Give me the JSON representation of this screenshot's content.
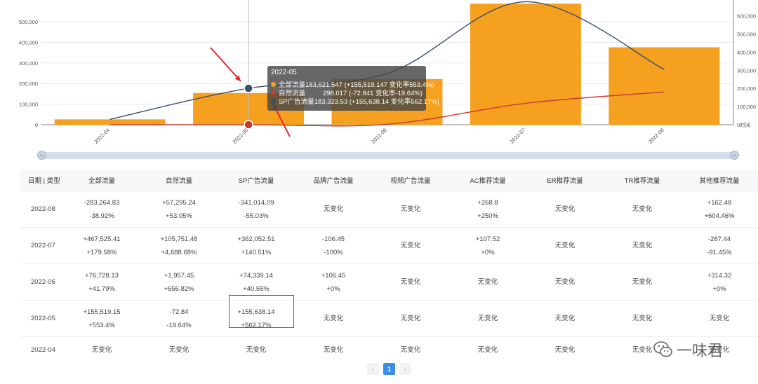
{
  "chart_data": {
    "type": "bar",
    "categories": [
      "2022-04",
      "2022-05",
      "2022-06",
      "2022-07",
      "2022-08"
    ],
    "bar_series": {
      "name": "全部流量",
      "values": [
        27000,
        160000,
        230000,
        610000,
        390000
      ],
      "color": "#f5a01e"
    },
    "line_series": [
      {
        "name": "SP广告流量",
        "values": [
          27000,
          183323.53,
          257662,
          619715,
          278701
        ],
        "color": "#3a4f6a"
      },
      {
        "name": "自然流量",
        "values": [
          0,
          298.017,
          2255,
          108000,
          165295
        ],
        "color": "#c73a32"
      }
    ],
    "ylim": [
      0,
      600000
    ],
    "y_ticks_left": [
      "0",
      "100,000",
      "200,000",
      "300,000",
      "400,000",
      "500,000"
    ],
    "y_ticks_right": [
      "0时间",
      "100,000",
      "200,000",
      "300,000",
      "400,000",
      "500,000",
      "600,000"
    ],
    "grid": true
  },
  "tooltip": {
    "title": "2022-05",
    "rows": [
      {
        "name": "全部流量",
        "value": "183,621.547 (+155,519.147 变化率553.4%)",
        "color": "#f5a01e"
      },
      {
        "name": "自然流量",
        "value": "298.017 (-72.841 变化率-19.64%)",
        "color": "#c73a32"
      },
      {
        "name": "SP广告流量",
        "value": "183,323.53 (+155,638.14 变化率562.17%)",
        "color": "#3a4f6a"
      }
    ]
  },
  "table": {
    "headers": [
      "日期 | 类型",
      "全部流量",
      "自然流量",
      "SP广告流量",
      "品牌广告流量",
      "视频广告流量",
      "AC推荐流量",
      "ER推荐流量",
      "TR推荐流量",
      "其他推荐流量"
    ],
    "rows": [
      {
        "date": "2022-08",
        "cells": [
          {
            "v": "-283,264.83",
            "p": "-38.92%",
            "s": "neg"
          },
          {
            "v": "+57,295.24",
            "p": "+53.05%",
            "s": "pos"
          },
          {
            "v": "-341,014.09",
            "p": "-55.03%",
            "s": "neg"
          },
          {
            "v": "无变化",
            "p": "",
            "s": "nochg"
          },
          {
            "v": "无变化",
            "p": "",
            "s": "nochg"
          },
          {
            "v": "+268.8",
            "p": "+250%",
            "s": "pos"
          },
          {
            "v": "无变化",
            "p": "",
            "s": "nochg"
          },
          {
            "v": "无变化",
            "p": "",
            "s": "nochg"
          },
          {
            "v": "+162.48",
            "p": "+604.46%",
            "s": "pos"
          }
        ]
      },
      {
        "date": "2022-07",
        "cells": [
          {
            "v": "+467,525.41",
            "p": "+179.58%",
            "s": "pos"
          },
          {
            "v": "+105,751.48",
            "p": "+4,688.68%",
            "s": "pos"
          },
          {
            "v": "+362,052.51",
            "p": "+140.51%",
            "s": "pos"
          },
          {
            "v": "-106.45",
            "p": "-100%",
            "s": "neg"
          },
          {
            "v": "无变化",
            "p": "",
            "s": "nochg"
          },
          {
            "v": "+107.52",
            "p": "+0%",
            "s": "pos"
          },
          {
            "v": "无变化",
            "p": "",
            "s": "nochg"
          },
          {
            "v": "无变化",
            "p": "",
            "s": "nochg"
          },
          {
            "v": "-287.44",
            "p": "-91.45%",
            "s": "neg"
          }
        ]
      },
      {
        "date": "2022-06",
        "cells": [
          {
            "v": "+76,728.13",
            "p": "+41.79%",
            "s": "pos"
          },
          {
            "v": "+1,957.45",
            "p": "+656.82%",
            "s": "pos"
          },
          {
            "v": "+74,339.14",
            "p": "+40.55%",
            "s": "pos"
          },
          {
            "v": "+106.45",
            "p": "+0%",
            "s": "pos"
          },
          {
            "v": "无变化",
            "p": "",
            "s": "nochg"
          },
          {
            "v": "无变化",
            "p": "",
            "s": "nochg"
          },
          {
            "v": "无变化",
            "p": "",
            "s": "nochg"
          },
          {
            "v": "无变化",
            "p": "",
            "s": "nochg"
          },
          {
            "v": "+314.32",
            "p": "+0%",
            "s": "pos"
          }
        ]
      },
      {
        "date": "2022-05",
        "cells": [
          {
            "v": "+155,519.15",
            "p": "+553.4%",
            "s": "pos"
          },
          {
            "v": "-72.84",
            "p": "-19.64%",
            "s": "neg"
          },
          {
            "v": "+155,638.14",
            "p": "+562.17%",
            "s": "pos"
          },
          {
            "v": "无变化",
            "p": "",
            "s": "nochg"
          },
          {
            "v": "无变化",
            "p": "",
            "s": "nochg"
          },
          {
            "v": "无变化",
            "p": "",
            "s": "nochg"
          },
          {
            "v": "无变化",
            "p": "",
            "s": "nochg"
          },
          {
            "v": "无变化",
            "p": "",
            "s": "nochg"
          },
          {
            "v": "无变化",
            "p": "",
            "s": "nochg"
          }
        ]
      },
      {
        "date": "2022-04",
        "cells": [
          {
            "v": "无变化",
            "p": "",
            "s": "nochg"
          },
          {
            "v": "无变化",
            "p": "",
            "s": "nochg"
          },
          {
            "v": "无变化",
            "p": "",
            "s": "nochg"
          },
          {
            "v": "无变化",
            "p": "",
            "s": "nochg"
          },
          {
            "v": "无变化",
            "p": "",
            "s": "nochg"
          },
          {
            "v": "无变化",
            "p": "",
            "s": "nochg"
          },
          {
            "v": "无变化",
            "p": "",
            "s": "nochg"
          },
          {
            "v": "无变化",
            "p": "",
            "s": "nochg"
          },
          {
            "v": "无变化",
            "p": "",
            "s": "nochg"
          }
        ]
      }
    ]
  },
  "pagination": {
    "prev": "‹",
    "current": "1",
    "next": "›"
  },
  "watermark": {
    "text": "一味君"
  },
  "colors": {
    "accent": "#3a8ee6",
    "positive": "#2f9c57",
    "negative": "#c24a43",
    "highlight": "#e8262a"
  }
}
